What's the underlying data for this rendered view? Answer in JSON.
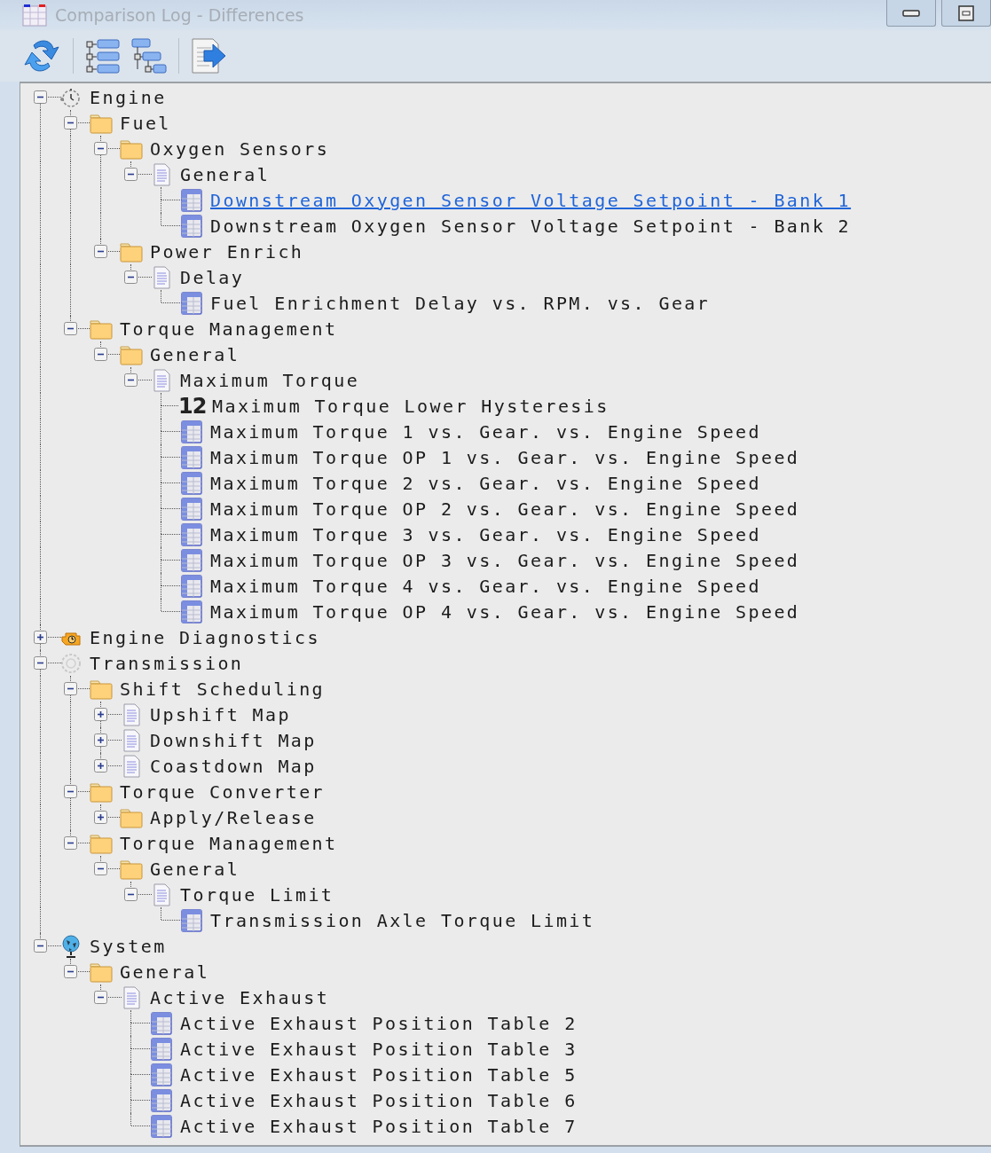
{
  "window": {
    "title": "Comparison Log - Differences"
  },
  "tree": [
    {
      "label": "Engine",
      "kind": "engine",
      "expanded": true,
      "selected": false,
      "children": [
        {
          "label": "Fuel",
          "kind": "folder",
          "expanded": true,
          "selected": false,
          "children": [
            {
              "label": "Oxygen Sensors",
              "kind": "folder",
              "expanded": true,
              "selected": false,
              "children": [
                {
                  "label": "General",
                  "kind": "document",
                  "expanded": true,
                  "selected": false,
                  "children": [
                    {
                      "label": "Downstream Oxygen Sensor Voltage Setpoint - Bank 1",
                      "kind": "table",
                      "selected": true
                    },
                    {
                      "label": "Downstream Oxygen Sensor Voltage Setpoint - Bank 2",
                      "kind": "table",
                      "selected": false
                    }
                  ]
                }
              ]
            },
            {
              "label": "Power Enrich",
              "kind": "folder",
              "expanded": true,
              "selected": false,
              "children": [
                {
                  "label": "Delay",
                  "kind": "document",
                  "expanded": true,
                  "selected": false,
                  "children": [
                    {
                      "label": "Fuel Enrichment Delay vs. RPM. vs. Gear",
                      "kind": "table",
                      "selected": false
                    }
                  ]
                }
              ]
            }
          ]
        },
        {
          "label": "Torque Management",
          "kind": "folder",
          "expanded": true,
          "selected": false,
          "children": [
            {
              "label": "General",
              "kind": "folder",
              "expanded": true,
              "selected": false,
              "children": [
                {
                  "label": "Maximum Torque",
                  "kind": "document",
                  "expanded": true,
                  "selected": false,
                  "children": [
                    {
                      "label": "Maximum Torque Lower Hysteresis",
                      "kind": "scalar",
                      "badge": "12",
                      "selected": false
                    },
                    {
                      "label": "Maximum Torque 1 vs. Gear. vs. Engine Speed",
                      "kind": "table",
                      "selected": false
                    },
                    {
                      "label": "Maximum Torque OP 1 vs. Gear. vs. Engine Speed",
                      "kind": "table",
                      "selected": false
                    },
                    {
                      "label": "Maximum Torque 2 vs. Gear. vs. Engine Speed",
                      "kind": "table",
                      "selected": false
                    },
                    {
                      "label": "Maximum Torque OP 2 vs. Gear. vs. Engine Speed",
                      "kind": "table",
                      "selected": false
                    },
                    {
                      "label": "Maximum Torque 3 vs. Gear. vs. Engine Speed",
                      "kind": "table",
                      "selected": false
                    },
                    {
                      "label": "Maximum Torque OP 3 vs. Gear. vs. Engine Speed",
                      "kind": "table",
                      "selected": false
                    },
                    {
                      "label": "Maximum Torque 4 vs. Gear. vs. Engine Speed",
                      "kind": "table",
                      "selected": false
                    },
                    {
                      "label": "Maximum Torque OP 4 vs. Gear. vs. Engine Speed",
                      "kind": "table",
                      "selected": false
                    }
                  ]
                }
              ]
            }
          ]
        }
      ]
    },
    {
      "label": "Engine Diagnostics",
      "kind": "diagnostics",
      "expanded": false,
      "selected": false
    },
    {
      "label": "Transmission",
      "kind": "transmission",
      "expanded": true,
      "selected": false,
      "children": [
        {
          "label": "Shift Scheduling",
          "kind": "folder",
          "expanded": true,
          "selected": false,
          "children": [
            {
              "label": "Upshift Map",
              "kind": "document",
              "expanded": false,
              "selected": false
            },
            {
              "label": "Downshift Map",
              "kind": "document",
              "expanded": false,
              "selected": false
            },
            {
              "label": "Coastdown Map",
              "kind": "document",
              "expanded": false,
              "selected": false
            }
          ]
        },
        {
          "label": "Torque Converter",
          "kind": "folder",
          "expanded": true,
          "selected": false,
          "children": [
            {
              "label": "Apply/Release",
              "kind": "folder",
              "expanded": false,
              "selected": false
            }
          ]
        },
        {
          "label": "Torque Management",
          "kind": "folder",
          "expanded": true,
          "selected": false,
          "children": [
            {
              "label": "General",
              "kind": "folder",
              "expanded": true,
              "selected": false,
              "children": [
                {
                  "label": "Torque Limit",
                  "kind": "document",
                  "expanded": true,
                  "selected": false,
                  "children": [
                    {
                      "label": "Transmission Axle Torque Limit",
                      "kind": "table",
                      "selected": false
                    }
                  ]
                }
              ]
            }
          ]
        }
      ]
    },
    {
      "label": "System",
      "kind": "system",
      "expanded": true,
      "selected": false,
      "children": [
        {
          "label": "General",
          "kind": "folder",
          "expanded": true,
          "selected": false,
          "children": [
            {
              "label": "Active Exhaust",
              "kind": "document",
              "expanded": true,
              "selected": false,
              "children": [
                {
                  "label": "Active Exhaust Position Table 2",
                  "kind": "table",
                  "selected": false
                },
                {
                  "label": "Active Exhaust Position Table 3",
                  "kind": "table",
                  "selected": false
                },
                {
                  "label": "Active Exhaust Position Table 5",
                  "kind": "table",
                  "selected": false
                },
                {
                  "label": "Active Exhaust Position Table 6",
                  "kind": "table",
                  "selected": false
                },
                {
                  "label": "Active Exhaust Position Table 7",
                  "kind": "table",
                  "selected": false
                }
              ]
            }
          ]
        }
      ]
    }
  ]
}
